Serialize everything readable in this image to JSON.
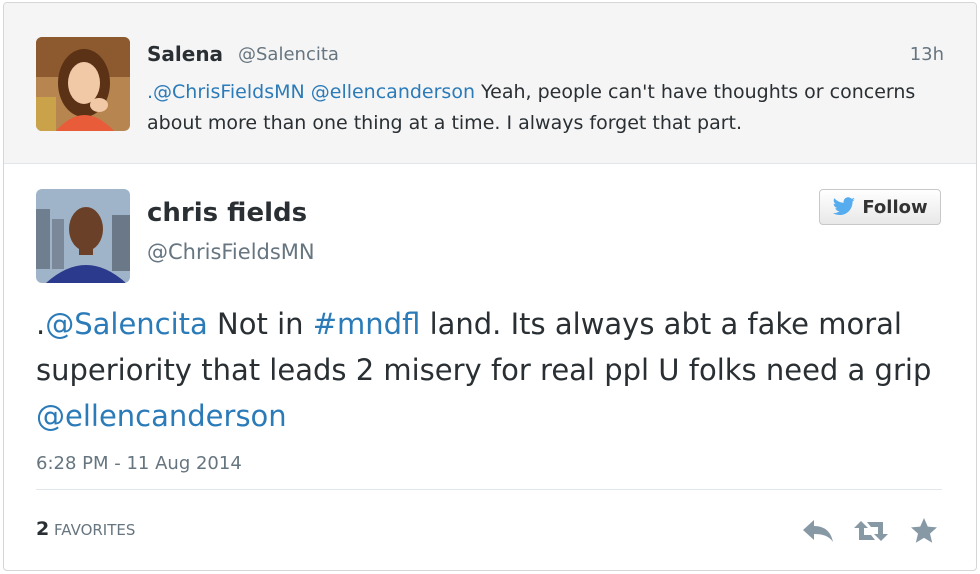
{
  "parent_tweet": {
    "name": "Salena",
    "handle": "@Salencita",
    "time": "13h",
    "mention1": ".@ChrisFieldsMN",
    "mention2": "@ellencanderson",
    "text": "Yeah, people can't have thoughts or concerns about more than one thing at a time. I always forget that part."
  },
  "main_tweet": {
    "name": "chris fields",
    "handle": "@ChrisFieldsMN",
    "follow_label": "Follow",
    "text": {
      "prefix": ".",
      "mention": "@Salencita",
      "part1": "Not in",
      "hashtag": "#mndfl",
      "part2": "land. Its always abt a fake moral superiority that leads 2 misery for real ppl U folks need a grip",
      "mention2": "@ellencanderson"
    },
    "timestamp": "6:28 PM - 11 Aug 2014",
    "favorites_count": "2",
    "favorites_label": "FAVORITES"
  },
  "icons": [
    "bird-icon",
    "reply-icon",
    "retweet-icon",
    "favorite-star-icon"
  ],
  "colors": {
    "link": "#2b7bb9",
    "bird": "#55acee",
    "action": "#8899a6"
  }
}
